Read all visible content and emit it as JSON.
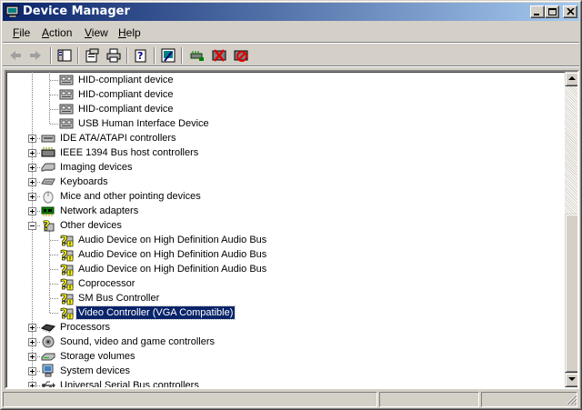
{
  "window": {
    "title": "Device Manager"
  },
  "menu": [
    {
      "label": "File",
      "accel": "F",
      "rest": "ile"
    },
    {
      "label": "Action",
      "accel": "A",
      "rest": "ction"
    },
    {
      "label": "View",
      "accel": "V",
      "rest": "iew"
    },
    {
      "label": "Help",
      "accel": "H",
      "rest": "elp"
    }
  ],
  "toolbar": {
    "buttons": [
      "back-icon",
      "forward-icon",
      "show-hide-console-tree-icon",
      "properties-icon",
      "print-icon",
      "help-icon",
      "scan-hardware-icon",
      "update-driver-icon",
      "uninstall-icon",
      "disable-icon"
    ]
  },
  "tree": {
    "rows": [
      {
        "label": "HID-compliant device",
        "level": 2,
        "icon": "hid-icon"
      },
      {
        "label": "HID-compliant device",
        "level": 2,
        "icon": "hid-icon"
      },
      {
        "label": "HID-compliant device",
        "level": 2,
        "icon": "hid-icon"
      },
      {
        "label": "USB Human Interface Device",
        "level": 2,
        "icon": "hid-icon"
      },
      {
        "label": "IDE ATA/ATAPI controllers",
        "level": 1,
        "icon": "ide-controller-icon",
        "expander": "plus"
      },
      {
        "label": "IEEE 1394 Bus host controllers",
        "level": 1,
        "icon": "firewire-icon",
        "expander": "plus"
      },
      {
        "label": "Imaging devices",
        "level": 1,
        "icon": "scanner-icon",
        "expander": "plus"
      },
      {
        "label": "Keyboards",
        "level": 1,
        "icon": "keyboard-icon",
        "expander": "plus"
      },
      {
        "label": "Mice and other pointing devices",
        "level": 1,
        "icon": "mouse-icon",
        "expander": "plus"
      },
      {
        "label": "Network adapters",
        "level": 1,
        "icon": "network-adapter-icon",
        "expander": "plus"
      },
      {
        "label": "Other devices",
        "level": 1,
        "icon": "unknown-device-icon",
        "expander": "minus"
      },
      {
        "label": "Audio Device on High Definition Audio Bus",
        "level": 2,
        "icon": "warning-device-icon"
      },
      {
        "label": "Audio Device on High Definition Audio Bus",
        "level": 2,
        "icon": "warning-device-icon"
      },
      {
        "label": "Audio Device on High Definition Audio Bus",
        "level": 2,
        "icon": "warning-device-icon"
      },
      {
        "label": "Coprocessor",
        "level": 2,
        "icon": "warning-device-icon"
      },
      {
        "label": "SM Bus Controller",
        "level": 2,
        "icon": "warning-device-icon"
      },
      {
        "label": "Video Controller (VGA Compatible)",
        "level": 2,
        "icon": "warning-device-icon",
        "selected": true
      },
      {
        "label": "Processors",
        "level": 1,
        "icon": "processor-icon",
        "expander": "plus"
      },
      {
        "label": "Sound, video and game controllers",
        "level": 1,
        "icon": "sound-icon",
        "expander": "plus"
      },
      {
        "label": "Storage volumes",
        "level": 1,
        "icon": "storage-volume-icon",
        "expander": "plus"
      },
      {
        "label": "System devices",
        "level": 1,
        "icon": "system-devices-icon",
        "expander": "plus"
      },
      {
        "label": "Universal Serial Bus controllers",
        "level": 1,
        "icon": "usb-icon",
        "expander": "plus"
      }
    ]
  },
  "colors": {
    "selection": "#0a246a",
    "titlebar_start": "#0a246a",
    "titlebar_end": "#a6caf0",
    "warning": "#ffff00"
  }
}
